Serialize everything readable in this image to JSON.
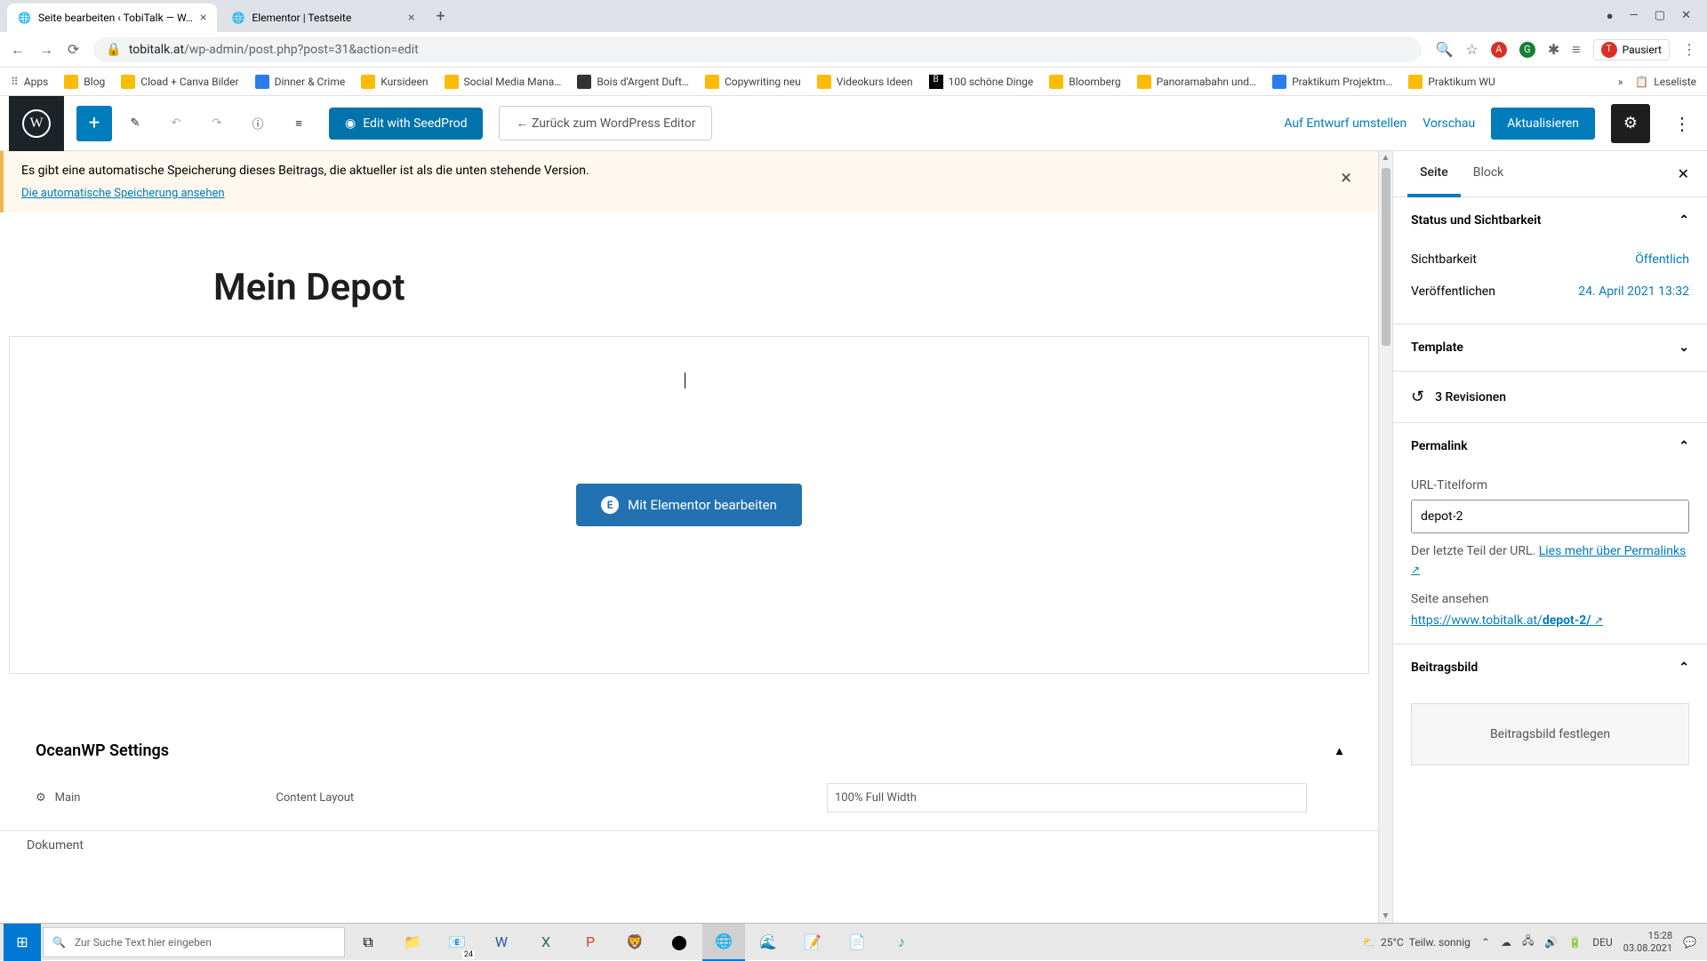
{
  "browser": {
    "tabs": [
      {
        "title": "Seite bearbeiten ‹ TobiTalk — W…"
      },
      {
        "title": "Elementor | Testseite"
      }
    ],
    "url_prefix": "tobitalk.at",
    "url_path": "/wp-admin/post.php?post=31&action=edit",
    "profile_status": "Pausiert",
    "bookmarks": [
      "Apps",
      "Blog",
      "Cload + Canva Bilder",
      "Dinner & Crime",
      "Kursideen",
      "Social Media Mana…",
      "Bois d'Argent Duft…",
      "Copywriting neu",
      "Videokurs Ideen",
      "100 schöne Dinge",
      "Bloomberg",
      "Panoramabahn und…",
      "Praktikum Projektm…",
      "Praktikum WU"
    ],
    "reading_list": "Leseliste"
  },
  "toolbar": {
    "seedprod": "Edit with SeedProd",
    "back_to_wp": "← Zurück zum WordPress Editor",
    "switch_draft": "Auf Entwurf umstellen",
    "preview": "Vorschau",
    "update": "Aktualisieren"
  },
  "notice": {
    "text": "Es gibt eine automatische Speicherung dieses Beitrags, die aktueller ist als die unten stehende Version.",
    "link": "Die automatische Speicherung ansehen"
  },
  "content": {
    "title": "Mein Depot",
    "elementor_btn": "Mit Elementor bearbeiten"
  },
  "oceanwp": {
    "title": "OceanWP Settings",
    "tab_main": "Main",
    "content_layout": "Content Layout",
    "layout_value": "100% Full Width"
  },
  "doc_footer": "Dokument",
  "sidebar": {
    "tab_page": "Seite",
    "tab_block": "Block",
    "status_header": "Status und Sichtbarkeit",
    "visibility_label": "Sichtbarkeit",
    "visibility_value": "Öffentlich",
    "publish_label": "Veröffentlichen",
    "publish_value": "24. April 2021 13:32",
    "template_header": "Template",
    "revisions": "3 Revisionen",
    "permalink_header": "Permalink",
    "url_form_label": "URL-Titelform",
    "url_form_value": "depot-2",
    "url_help_text": "Der letzte Teil der URL. ",
    "url_help_link": "Lies mehr über Permalinks",
    "view_page": "Seite ansehen",
    "page_url_prefix": "https://www.tobitalk.at/",
    "page_url_slug": "depot-2/",
    "featured_header": "Beitragsbild",
    "featured_set": "Beitragsbild festlegen"
  },
  "taskbar": {
    "search_placeholder": "Zur Suche Text hier eingeben",
    "weather_temp": "25°C",
    "weather_desc": "Teilw. sonnig",
    "lang": "DEU",
    "time": "15:28",
    "date": "03.08.2021",
    "mail_badge": "24"
  }
}
